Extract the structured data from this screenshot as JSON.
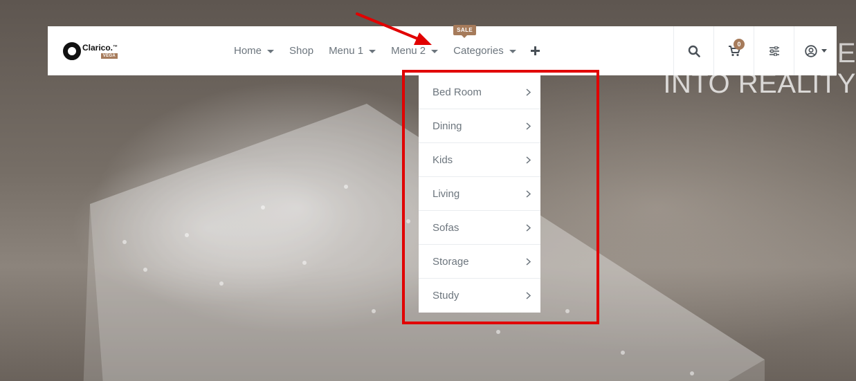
{
  "hero": {
    "line1": "E",
    "line2": "INTO REALITY"
  },
  "logo": {
    "name": "Clarico.",
    "tm": "™",
    "sub": "VEGA"
  },
  "nav": {
    "items": [
      {
        "label": "Home",
        "has_caret": true
      },
      {
        "label": "Shop",
        "has_caret": false
      },
      {
        "label": "Menu 1",
        "has_caret": true
      },
      {
        "label": "Menu 2",
        "has_caret": true
      },
      {
        "label": "Categories",
        "has_caret": true,
        "badge": "SALE"
      }
    ],
    "plus_icon": "plus-icon"
  },
  "actions": {
    "search_icon": "search-icon",
    "cart_icon": "cart-icon",
    "cart_count": "0",
    "filter_icon": "sliders-icon",
    "user_icon": "user-circle-icon"
  },
  "dropdown": {
    "items": [
      {
        "label": "Bed Room"
      },
      {
        "label": "Dining"
      },
      {
        "label": "Kids"
      },
      {
        "label": "Living"
      },
      {
        "label": "Sofas"
      },
      {
        "label": "Storage"
      },
      {
        "label": "Study"
      }
    ]
  },
  "colors": {
    "accent": "#a67b5b",
    "annotation": "#e10000",
    "nav_text": "#6c757d"
  }
}
